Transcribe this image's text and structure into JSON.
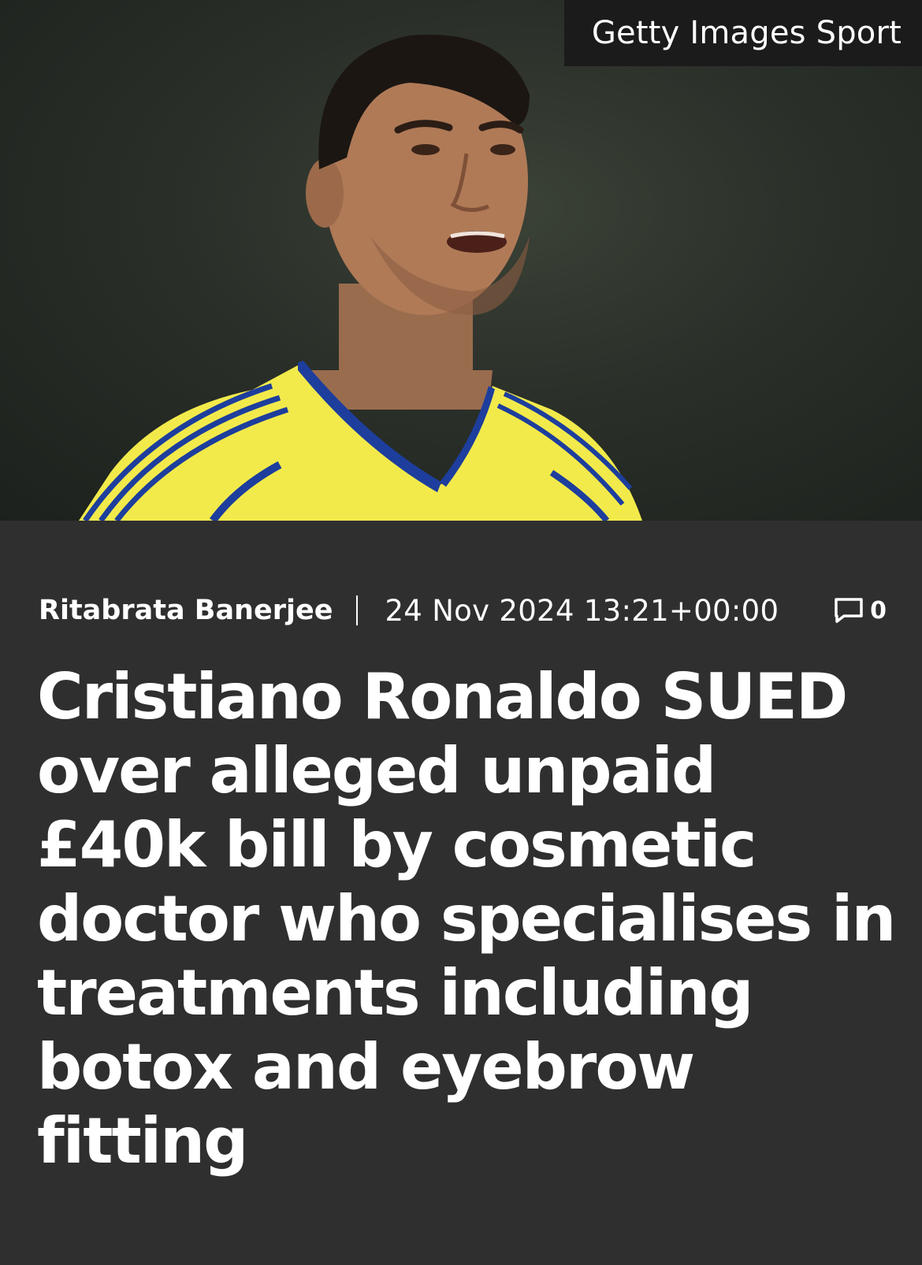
{
  "hero": {
    "image_credit": "Getty Images Sport",
    "image_subject": "Cristiano Ronaldo in yellow and blue jersey"
  },
  "article": {
    "author": "Ritabrata Banerjee",
    "date": "24 Nov 2024 13:21+00:00",
    "comment_count": "0",
    "headline": "Cristiano Ronaldo SUED over alleged unpaid £40k bill by cosmetic doctor who specialises in treatments including botox and eyebrow fitting"
  },
  "colors": {
    "background": "#2f2f2f",
    "text": "#ffffff",
    "credit_background": "#1b1b1b",
    "jersey_yellow": "#f2ea4b",
    "jersey_blue": "#1d3e9c"
  },
  "icons": {
    "comment": "speech-bubble-icon"
  }
}
